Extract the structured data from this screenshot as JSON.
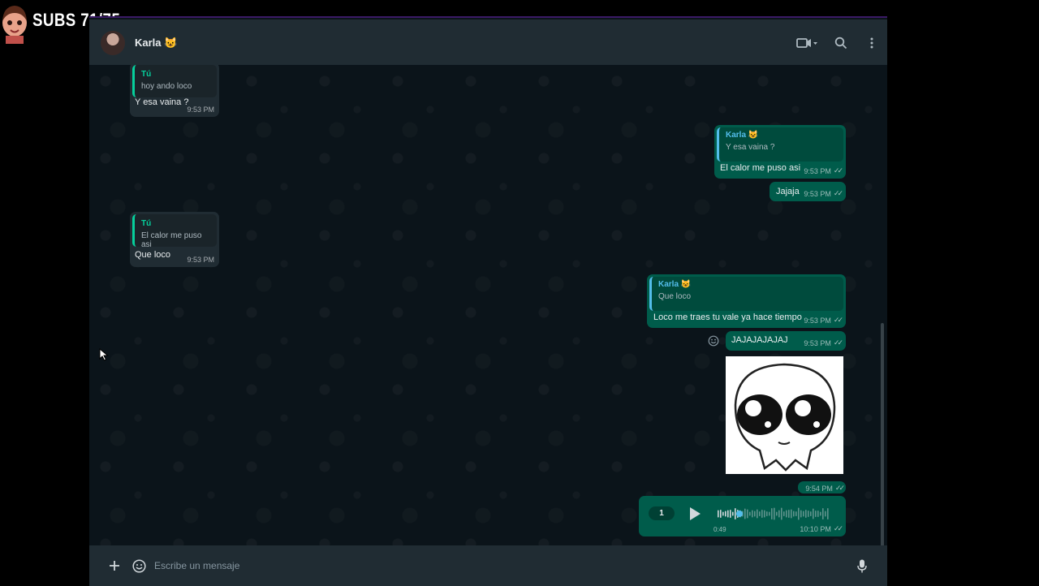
{
  "overlay": {
    "subs_label": "SUBS 71/75"
  },
  "header": {
    "contact_name": "Karla 😺"
  },
  "messages": [
    {
      "quote_name": "Tú",
      "quote_text": "hoy ando loco",
      "text": "Y esa vaina ?",
      "time": "9:53 PM"
    },
    {
      "quote_name": "Karla 😺",
      "quote_text": "Y esa vaina ?",
      "text": "El calor me puso asi",
      "time": "9:53 PM"
    },
    {
      "text": "Jajaja",
      "time": "9:53 PM"
    },
    {
      "quote_name": "Tú",
      "quote_text": "El calor me puso asi",
      "text": "Que loco",
      "time": "9:53 PM"
    },
    {
      "quote_name": "Karla 😺",
      "quote_text": "Que loco",
      "text": "Loco me traes tu vale ya hace tiempo",
      "time": "9:53 PM"
    },
    {
      "text": "JAJAJAJAJAJ",
      "time": "9:53 PM"
    },
    {
      "sticker": "cute-alien-sticker",
      "time": "9:54 PM"
    },
    {
      "voice": {
        "speed": "1",
        "duration": "0:49"
      },
      "time": "10:10 PM"
    }
  ],
  "footer": {
    "placeholder": "Escribe un mensaje"
  },
  "icons": {
    "video": "video-camera-icon",
    "search": "search-icon",
    "menu": "kebab-menu-icon",
    "plus": "plus-icon",
    "emoji": "emoji-icon",
    "mic": "microphone-icon",
    "play": "play-icon",
    "react": "smiley-react-icon"
  },
  "colors": {
    "incoming": "#202c33",
    "outgoing": "#005c4b",
    "background": "#0b141a",
    "accent": "#06cf9c"
  }
}
